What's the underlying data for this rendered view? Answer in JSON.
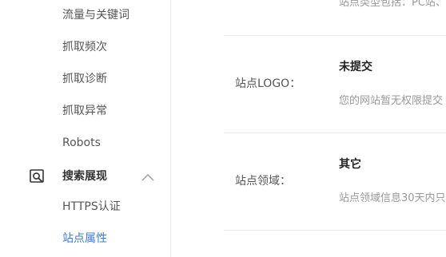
{
  "sidebar": {
    "items_above": [
      {
        "label": "流量与关键词"
      },
      {
        "label": "抓取频次"
      },
      {
        "label": "抓取诊断"
      },
      {
        "label": "抓取异常"
      },
      {
        "label": "Robots"
      }
    ],
    "section": {
      "label": "搜索展现",
      "icon": "search-window-icon",
      "expanded": true
    },
    "section_items": [
      {
        "label": "HTTPS认证",
        "active": false
      },
      {
        "label": "站点属性",
        "active": true
      }
    ],
    "colors": {
      "active": "#3b7ddd",
      "text": "#555555"
    }
  },
  "main": {
    "top_desc": "站点类型包括：PC站、",
    "rows": [
      {
        "label": "站点LOGO：",
        "value": "未提交",
        "desc": "您的网站暂无权限提交"
      },
      {
        "label": "站点领域：",
        "value": "其它",
        "desc": "站点领域信息30天内只"
      }
    ]
  }
}
